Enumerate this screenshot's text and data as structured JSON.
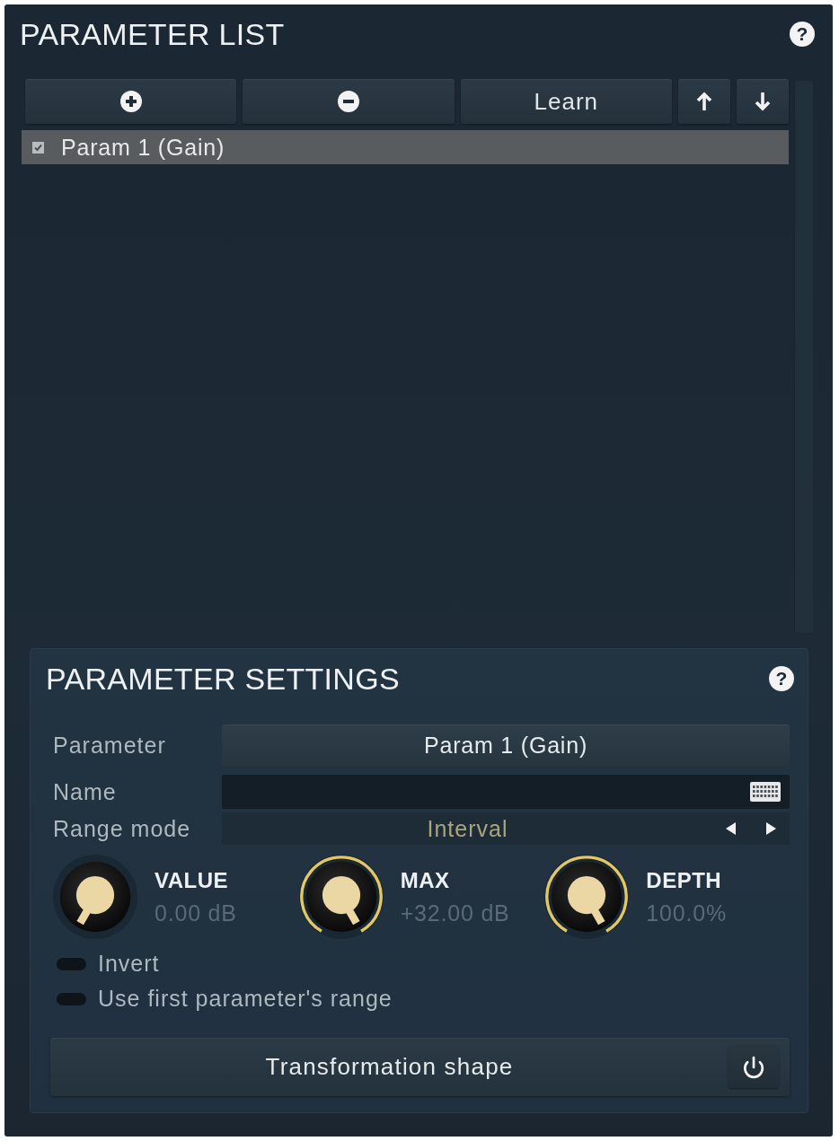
{
  "parameter_list": {
    "title": "PARAMETER LIST",
    "help": "?",
    "toolbar": [
      {
        "kind": "add"
      },
      {
        "kind": "remove"
      },
      {
        "kind": "text",
        "label": "Learn"
      },
      {
        "kind": "up"
      },
      {
        "kind": "down"
      }
    ],
    "items": [
      {
        "label": "Param 1 (Gain)",
        "checked": true,
        "selected": true
      }
    ]
  },
  "parameter_settings": {
    "title": "PARAMETER SETTINGS",
    "help": "?",
    "fields": [
      {
        "kind": "button",
        "label": "Parameter",
        "value": "Param 1 (Gain)"
      },
      {
        "kind": "text",
        "label": "Name"
      },
      {
        "kind": "selector",
        "label": "Range mode",
        "value": "Interval"
      }
    ],
    "knobs": [
      {
        "label": "VALUE",
        "reading": "0.00 dB",
        "level": 0
      },
      {
        "label": "MAX",
        "reading": "+32.00 dB",
        "level": 1
      },
      {
        "label": "DEPTH",
        "reading": "100.0%",
        "level": 1
      }
    ],
    "switches": [
      {
        "label": "Invert",
        "on": false
      },
      {
        "label": "Use first parameter's range",
        "on": false
      }
    ],
    "shape_button": {
      "label": "Transformation shape"
    }
  }
}
